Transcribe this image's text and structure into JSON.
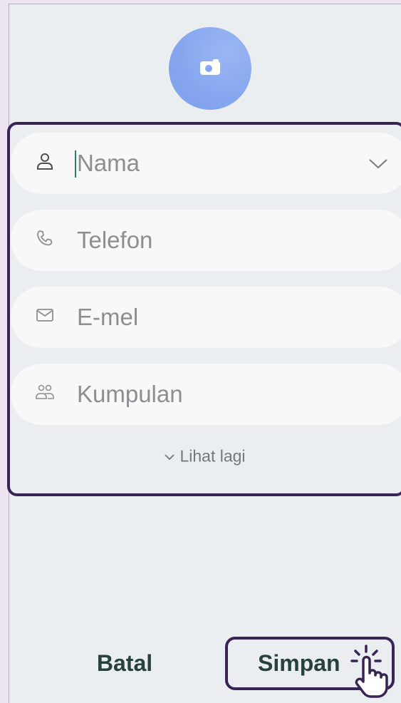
{
  "form": {
    "fields": [
      {
        "id": "name",
        "label": "Nama",
        "icon": "person-icon",
        "focused": true
      },
      {
        "id": "phone",
        "label": "Telefon",
        "icon": "phone-icon"
      },
      {
        "id": "email",
        "label": "E-mel",
        "icon": "mail-icon"
      },
      {
        "id": "group",
        "label": "Kumpulan",
        "icon": "group-icon"
      }
    ],
    "more_label": "Lihat lagi"
  },
  "actions": {
    "cancel_label": "Batal",
    "save_label": "Simpan"
  },
  "colors": {
    "avatar": "#86a7ef",
    "highlight_border": "#3a2356",
    "button_text": "#29413d",
    "cursor": "#2e7d6b"
  }
}
